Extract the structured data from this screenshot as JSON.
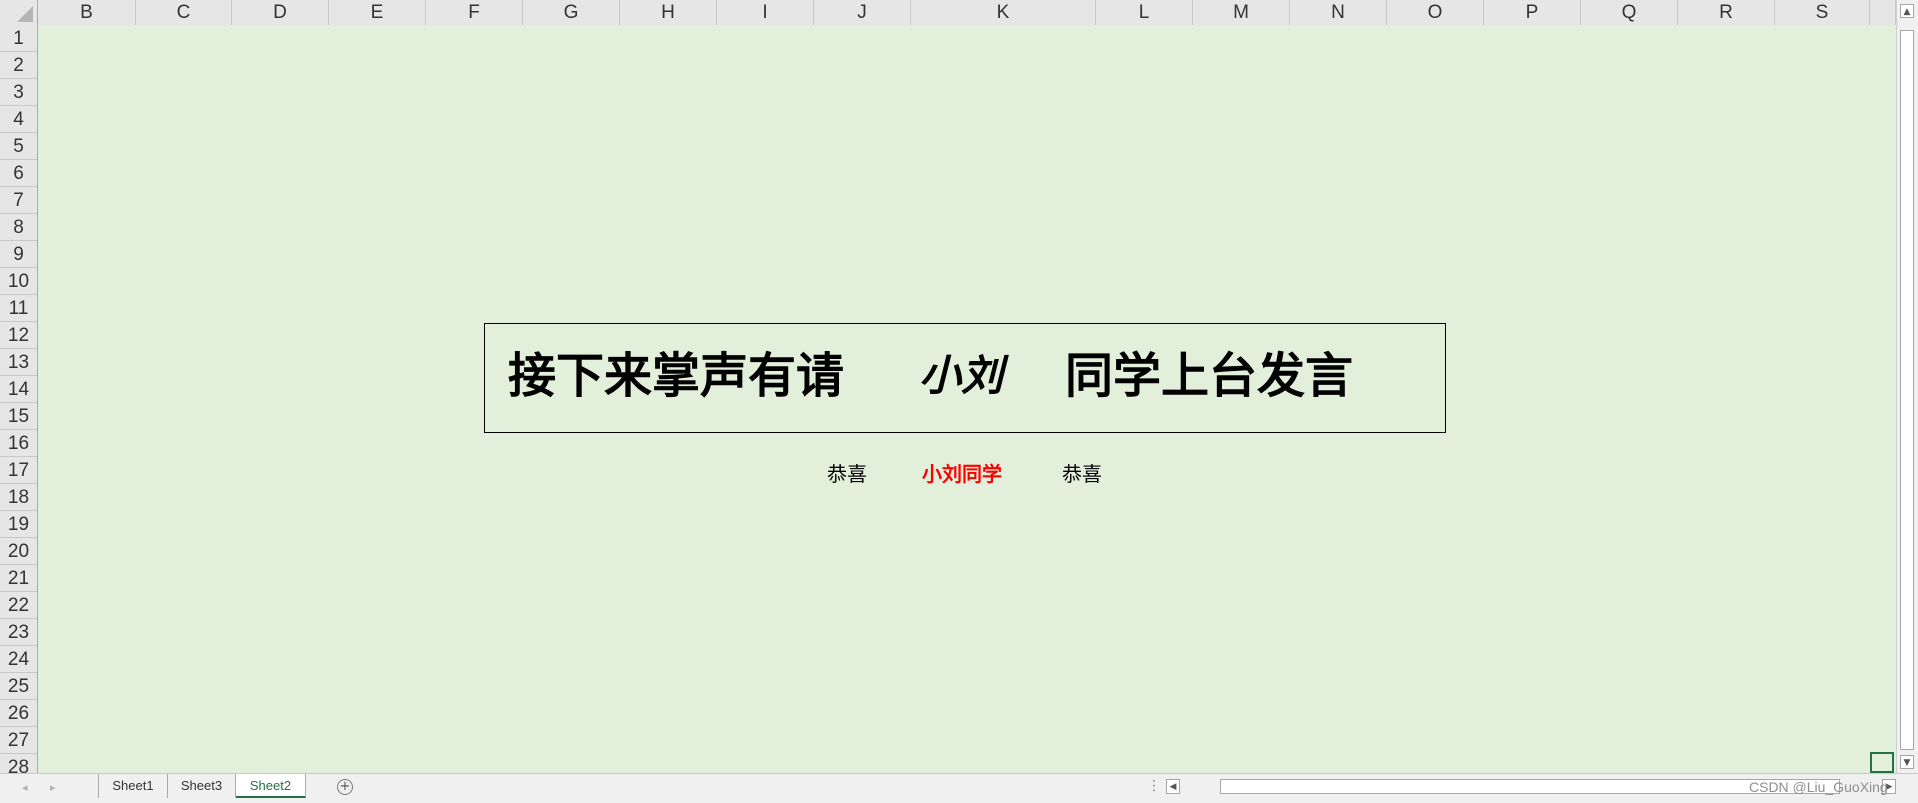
{
  "spreadsheet": {
    "columns": [
      "B",
      "C",
      "D",
      "E",
      "F",
      "G",
      "H",
      "I",
      "J",
      "K",
      "L",
      "M",
      "N",
      "O",
      "P",
      "Q",
      "R",
      "S"
    ],
    "rows": [
      "1",
      "2",
      "3",
      "4",
      "5",
      "6",
      "7",
      "8",
      "9",
      "10",
      "11",
      "12",
      "13",
      "14",
      "15",
      "16",
      "17",
      "18",
      "19",
      "20",
      "21",
      "22",
      "23",
      "24",
      "25",
      "26",
      "27",
      "28"
    ]
  },
  "banner": {
    "text_left": "接下来掌声有请",
    "name": "小刘",
    "text_right": "同学上台发言"
  },
  "line2": {
    "congrats_1": "恭喜",
    "name": "小刘同学",
    "congrats_2": "恭喜"
  },
  "sheet_tabs": [
    "Sheet1",
    "Sheet3",
    "Sheet2"
  ],
  "active_tab": "Sheet2",
  "colors": {
    "grid_fill": "#e2efda",
    "accent": "#217346",
    "highlight_name": "#ff0000"
  },
  "icons": {
    "prev_sheet": "◂",
    "next_sheet": "▸",
    "add_sheet": "+",
    "scroll_up": "▲",
    "scroll_down": "▼",
    "scroll_left": "◀",
    "scroll_right": "▶",
    "more_dots": "⋮"
  },
  "watermark": "CSDN @Liu_GuoXing"
}
